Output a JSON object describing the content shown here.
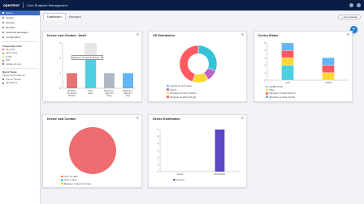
{
  "topbar": {
    "logo": "opentext",
    "title": "Core Endpoint Management"
  },
  "sidebar": {
    "nav": [
      {
        "label": "Home"
      },
      {
        "label": "Activity"
      },
      {
        "label": "Devices"
      },
      {
        "label": "Bundles"
      },
      {
        "label": "Audit and Messages"
      },
      {
        "label": "Configuration"
      }
    ],
    "favorites_header": "Frequently Used",
    "favorites": [
      {
        "label": "My_profil",
        "color": "#e53935"
      },
      {
        "label": "agent setup",
        "color": "#43a047"
      },
      {
        "label": "profile",
        "color": "#fdd835"
      },
      {
        "label": "W11",
        "color": "#1e88e5"
      },
      {
        "label": "update win max",
        "color": "#8e24aa"
      }
    ],
    "quicktasks_header": "Quick Tasks",
    "quicktasks_subheader": "Display Quick Tasks for:",
    "quicktasks": [
      {
        "label": "Current Section"
      },
      {
        "label": "All Sections"
      }
    ]
  },
  "tabs": [
    {
      "label": "Dashboard"
    },
    {
      "label": "Managed"
    }
  ],
  "new_button": "New Dashlet",
  "fab": "+",
  "cards": {
    "last_contact_audit": {
      "title": "Device Last Contact - Audit",
      "tooltip": "Between 31 days & 90 days: 2",
      "chart_data": {
        "type": "bar",
        "categories": [
          "Between 31 days & 90 days",
          "Over 1 days",
          "Between 1 day & 31 days",
          "Between 1 days & 7 days"
        ],
        "values": [
          1,
          2,
          1,
          1
        ],
        "ylim": [
          0,
          3
        ],
        "colors": [
          "#e57373",
          "#4dd0e1",
          "#b0b8c4",
          "#64b5f6"
        ]
      }
    },
    "os_distribution": {
      "title": "OS Distribution",
      "chart_data": {
        "type": "pie",
        "labels": [
          "macOS 14 and newer",
          "Others",
          "Windows 10 22H2 (64-bit)",
          "Windows 11 22H2 (64-bit)"
        ],
        "values": [
          31,
          10,
          14,
          45
        ],
        "colors": [
          "#34c3d6",
          "#ba68c8",
          "#fdd835",
          "#ff5a5f"
        ]
      }
    },
    "device_status": {
      "title": "Device Status",
      "chart_data": {
        "type": "bar",
        "categories": [
          "Lock",
          "Unlock"
        ],
        "series": [
          {
            "name": "Intel(R) 64-bit",
            "values": [
              2,
              0
            ],
            "color": "#4dd0e1"
          },
          {
            "name": "Other",
            "values": [
              1,
              1
            ],
            "color": "#fdd835"
          },
          {
            "name": "Windows 10 22H2 (64-bit)",
            "values": [
              1,
              1
            ],
            "color": "#ff5a5f"
          },
          {
            "name": "Windows 11 22H2 (64-bit)",
            "values": [
              1,
              1
            ],
            "color": "#64b5f6"
          }
        ],
        "ylim": [
          0,
          5
        ]
      }
    },
    "last_contact": {
      "title": "Device Last Contact",
      "chart_data": {
        "type": "pie",
        "labels": [
          "Over 31 days",
          "Over 1 days",
          "Between 1 days & 31 days"
        ],
        "values": [
          100,
          0,
          0
        ],
        "colors": [
          "#ef6c70",
          "#4dd0e1",
          "#fdd835"
        ]
      }
    },
    "device_distribution": {
      "title": "Device Distribution",
      "chart_data": {
        "type": "bar",
        "categories": [
          "Server",
          "Workstation"
        ],
        "series": [
          {
            "name": "Devices",
            "values": [
              0,
              6
            ],
            "color": "#5c48c7"
          }
        ],
        "ylim": [
          0,
          6
        ]
      }
    }
  }
}
